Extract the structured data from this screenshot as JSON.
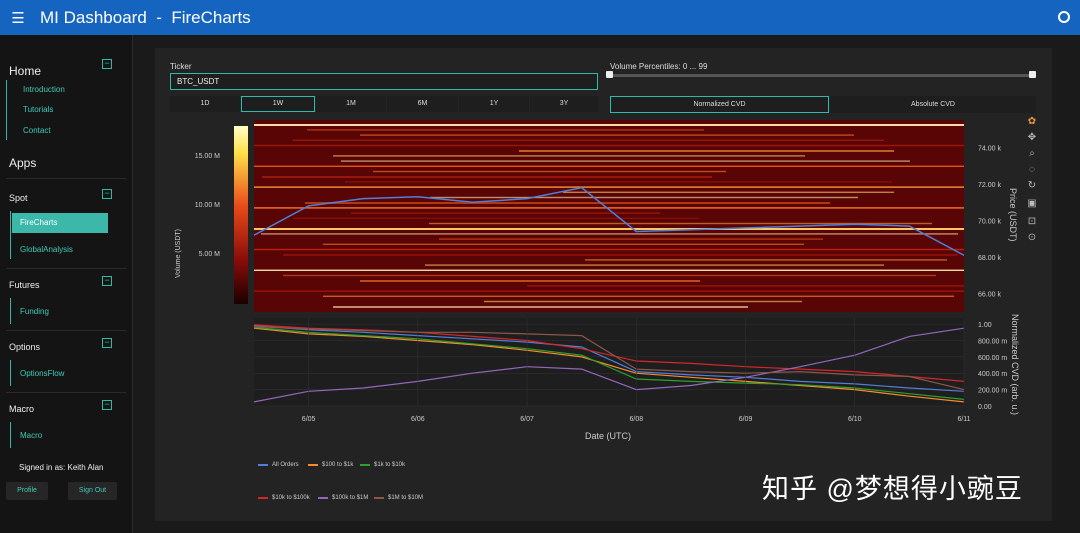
{
  "app": {
    "title": "MI Dashboard  -  FireCharts"
  },
  "sidebar": {
    "home": {
      "title": "Home",
      "links": [
        "Introduction",
        "Tutorials",
        "Contact"
      ]
    },
    "apps_title": "Apps",
    "spot": {
      "title": "Spot",
      "links": [
        "FireCharts",
        "GlobalAnalysis"
      ]
    },
    "futures": {
      "title": "Futures",
      "links": [
        "Funding"
      ]
    },
    "options": {
      "title": "Options",
      "links": [
        "OptionsFlow"
      ]
    },
    "macro": {
      "title": "Macro",
      "links": [
        "Macro"
      ]
    },
    "signed_in": "Signed in as: Keith Alan",
    "profile_label": "Profile",
    "signout_label": "Sign Out"
  },
  "controls": {
    "ticker_label": "Ticker",
    "ticker_value": "BTC_USDT",
    "percentile_label": "Volume Percentiles: 0 ... 99",
    "percentile_range": [
      0,
      99
    ],
    "timeframes": [
      "1D",
      "1W",
      "1M",
      "6M",
      "1Y",
      "3Y"
    ],
    "active_timeframe": "1W",
    "cvd_modes": [
      "Normalized CVD",
      "Absolute CVD"
    ],
    "active_cvd": "Normalized CVD"
  },
  "chart": {
    "colorbar_title": "Volume (USDT)",
    "colorbar_ticks": [
      "15.00 M",
      "10.00 M",
      "5.00 M"
    ],
    "price_axis_title": "Price (USDT)",
    "price_ticks": [
      "74.00 k",
      "72.00 k",
      "70.00 k",
      "68.00 k",
      "66.00 k"
    ],
    "cvd_axis_title": "Normalized CVD (arb. u.)",
    "cvd_ticks": [
      "1.00",
      "800.00 m",
      "600.00 m",
      "400.00 m",
      "200.00 m",
      "0.00"
    ],
    "x_ticks": [
      "6/05",
      "6/06",
      "6/07",
      "6/08",
      "6/09",
      "6/10",
      "6/11"
    ],
    "x_title": "Date (UTC)"
  },
  "chart_data": {
    "type": "line",
    "x": [
      "6/04 12:00",
      "6/05",
      "6/05 12:00",
      "6/06",
      "6/06 12:00",
      "6/07",
      "6/07 12:00",
      "6/08",
      "6/08 12:00",
      "6/09",
      "6/09 12:00",
      "6/10",
      "6/10 12:00",
      "6/11"
    ],
    "price_series": {
      "name": "Price (USDT)",
      "values": [
        69200,
        70800,
        71200,
        71300,
        71000,
        71200,
        71800,
        69400,
        69500,
        69600,
        69700,
        69800,
        69700,
        68100
      ]
    },
    "price_ylim": [
      65000,
      75500
    ],
    "series": [
      {
        "name": "All Orders",
        "color": "#4f7fd8",
        "values": [
          0.98,
          0.93,
          0.9,
          0.86,
          0.82,
          0.78,
          0.72,
          0.42,
          0.38,
          0.35,
          0.3,
          0.27,
          0.22,
          0.18
        ]
      },
      {
        "name": "$100 to $1k",
        "color": "#f58b2d",
        "values": [
          0.95,
          0.88,
          0.85,
          0.8,
          0.75,
          0.68,
          0.6,
          0.4,
          0.35,
          0.3,
          0.25,
          0.2,
          0.12,
          0.05
        ]
      },
      {
        "name": "$1k to $10k",
        "color": "#2ca02c",
        "values": [
          0.96,
          0.9,
          0.86,
          0.82,
          0.76,
          0.7,
          0.62,
          0.33,
          0.3,
          0.28,
          0.26,
          0.22,
          0.15,
          0.08
        ]
      },
      {
        "name": "$10k to $100k",
        "color": "#d62728",
        "values": [
          0.99,
          0.95,
          0.93,
          0.9,
          0.85,
          0.8,
          0.7,
          0.55,
          0.52,
          0.48,
          0.45,
          0.42,
          0.36,
          0.3
        ]
      },
      {
        "name": "$100k to $1M",
        "color": "#9467bd",
        "values": [
          0.05,
          0.18,
          0.22,
          0.3,
          0.4,
          0.48,
          0.45,
          0.2,
          0.25,
          0.35,
          0.48,
          0.62,
          0.85,
          0.95
        ]
      },
      {
        "name": "$1M to $10M",
        "color": "#8c564b",
        "values": [
          0.97,
          0.94,
          0.92,
          0.9,
          0.9,
          0.88,
          0.86,
          0.45,
          0.42,
          0.4,
          0.42,
          0.38,
          0.36,
          0.2
        ]
      }
    ],
    "cvd_ylim": [
      0,
      1.05
    ]
  },
  "legend": [
    "All Orders",
    "$100 to $1k",
    "$1k to $10k",
    "$10k to $100k",
    "$100k to $1M",
    "$1M to $10M"
  ],
  "colors": {
    "topbar": "#1565c0",
    "accent": "#2fb9a7"
  },
  "watermark": "知乎 @梦想得小豌豆"
}
